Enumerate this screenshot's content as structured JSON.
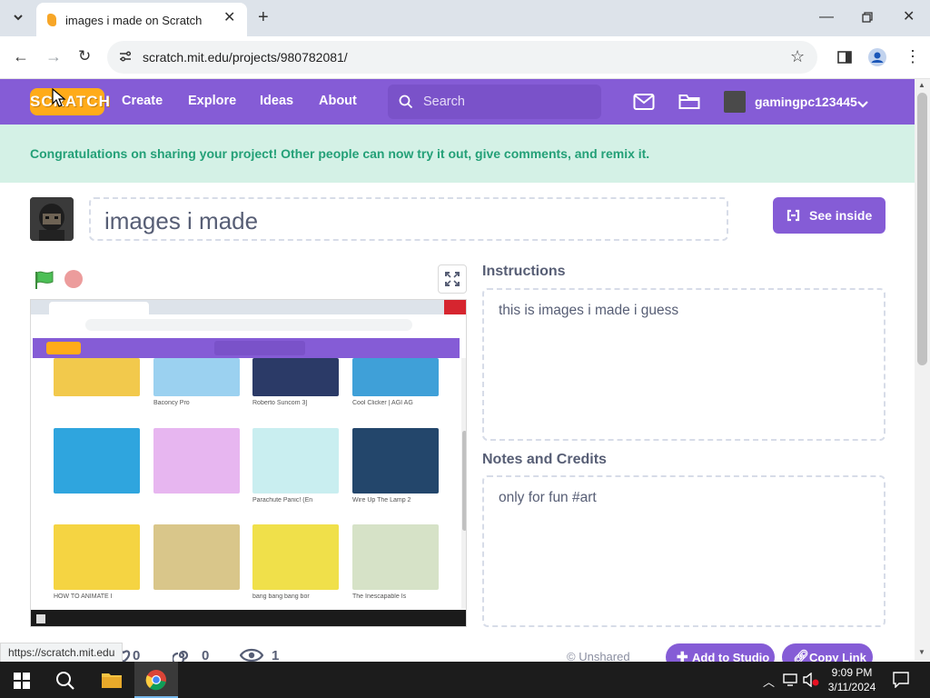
{
  "browser": {
    "tab_title": "images i made on Scratch",
    "url": "scratch.mit.edu/projects/980782081/",
    "status_url": "https://scratch.mit.edu"
  },
  "nav": {
    "logo_text": "SCRATCH",
    "links": [
      "Create",
      "Explore",
      "Ideas",
      "About"
    ],
    "search_placeholder": "Search",
    "username": "gamingpc123445"
  },
  "banner": {
    "text": "Congratulations on sharing your project! Other people can now try it out, give comments, and remix it."
  },
  "project": {
    "title": "images i made",
    "see_inside": "See inside",
    "instructions_heading": "Instructions",
    "instructions": "this is images i made i guess",
    "notes_heading": "Notes and Credits",
    "notes": "only for fun #art"
  },
  "stage_preview": {
    "cards": [
      {
        "caption": "",
        "by": "",
        "color": "#f2c94c"
      },
      {
        "caption": "Baconcy Pro",
        "by": "",
        "color": "#9bd1f0"
      },
      {
        "caption": "Roberto Suncom 3]",
        "by": "",
        "color": "#2b3a67"
      },
      {
        "caption": "Cool Clicker | AGI AG",
        "by": "",
        "color": "#3fa0d8"
      },
      {
        "caption": "",
        "by": "",
        "color": "#2fa5de"
      },
      {
        "caption": "",
        "by": "",
        "color": "#e7b6f0"
      },
      {
        "caption": "Parachute Panic! (En",
        "by": "",
        "color": "#c9eef0"
      },
      {
        "caption": "Wire Up The Lamp 2",
        "by": "",
        "color": "#23466b"
      },
      {
        "caption": "HOW TO ANIMATE I",
        "by": "",
        "color": "#f5d442"
      },
      {
        "caption": "",
        "by": "",
        "color": "#d9c68a"
      },
      {
        "caption": "bang bang bang bor",
        "by": "",
        "color": "#f0e04a"
      },
      {
        "caption": "The Inescapable Is",
        "by": "",
        "color": "#d6e2c7"
      }
    ]
  },
  "footer": {
    "stats": [
      "0",
      "0",
      "1"
    ],
    "unshared_label": "Unshared",
    "add_to_studio": "Add to Studio",
    "copy_link": "Copy Link"
  },
  "taskbar": {
    "time": "9:09 PM",
    "date": "3/11/2024"
  },
  "colors": {
    "scratch_purple": "#855cd6",
    "banner_bg": "#d4f1e6",
    "banner_text": "#23a077",
    "flag_green": "#4cbf56"
  }
}
